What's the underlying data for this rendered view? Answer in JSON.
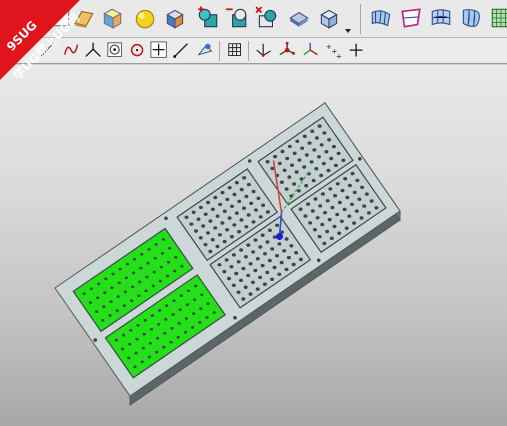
{
  "watermark": {
    "line1": "9SUG",
    "line2": "学UG就上UG网",
    "color": "#e0141c"
  },
  "toolbar_row1": {
    "buttons": [
      "sketch-icon",
      "extrude-icon",
      "shaded-box-icon",
      "sphere-icon",
      "primitive-box-icon",
      "boolean-unite-icon",
      "boolean-subtract-icon",
      "boolean-intersect-icon",
      "solid-block-icon",
      "view-cube-icon",
      "surface-ruled-icon",
      "surface-through-curves-icon",
      "surface-mesh-icon",
      "surface-bounded-icon",
      "surface-grid-icon"
    ]
  },
  "toolbar_row2": {
    "buttons": [
      "line-icon",
      "curve-spline-icon",
      "arc-icon",
      "point-icon",
      "circle-icon",
      "crosshair-icon",
      "slash-icon",
      "snap-icon",
      "grid-icon",
      "axis-icon",
      "datum-csys-icon",
      "csys-icon",
      "point-set-icon",
      "cross-icon"
    ]
  },
  "model": {
    "body_color": "#ccd8d8",
    "pocket_color": "#23e018",
    "hole_color": "#3a4646",
    "edge_color": "#505858",
    "highlight_color": "#1c1cd8",
    "triad": {
      "x": "#d84040",
      "y": "#3cb040",
      "z": "#4040d8"
    }
  }
}
